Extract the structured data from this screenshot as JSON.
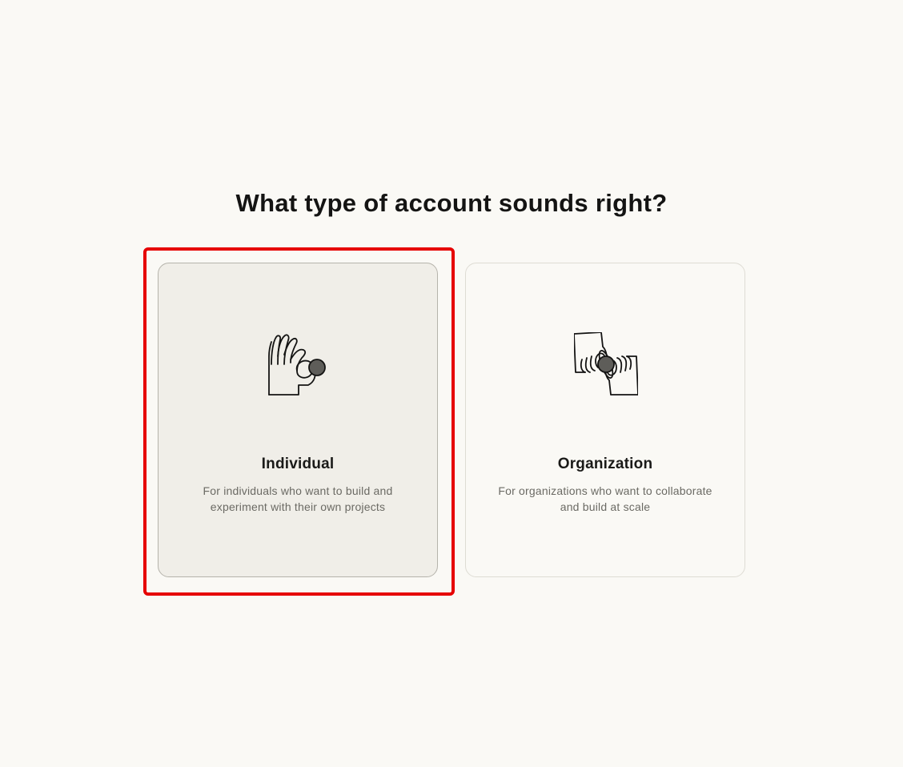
{
  "page": {
    "title": "What type of account sounds right?"
  },
  "options": [
    {
      "title": "Individual",
      "description": "For individuals who want to build and experiment with their own projects",
      "icon": "hand-holding-ball-icon",
      "selected": true
    },
    {
      "title": "Organization",
      "description": "For organizations who want to collaborate and build at scale",
      "icon": "two-hands-passing-ball-icon",
      "selected": false
    }
  ],
  "colors": {
    "background": "#faf9f5",
    "selected_card": "#f0eee8",
    "highlight": "#e60000",
    "text": "#141413",
    "muted_text": "#6b6a64"
  }
}
